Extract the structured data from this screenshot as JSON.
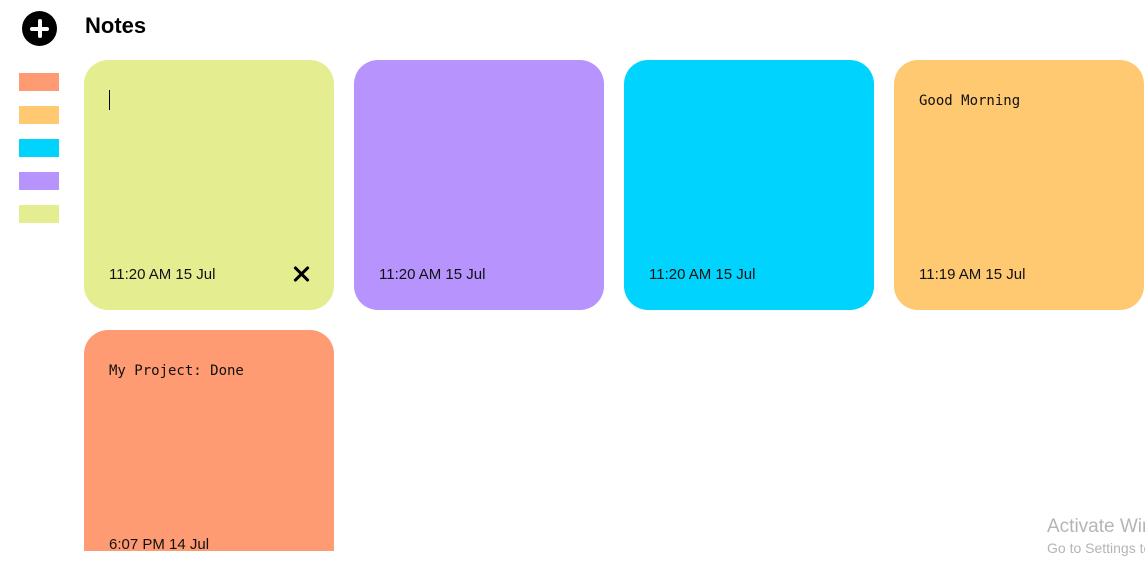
{
  "header": {
    "title": "Notes"
  },
  "sidebar": {
    "add_icon": "plus-circle-icon",
    "swatches": [
      {
        "color": "#fe9b72"
      },
      {
        "color": "#fec971"
      },
      {
        "color": "#00d4fe"
      },
      {
        "color": "#b693fd"
      },
      {
        "color": "#e4ee91"
      }
    ]
  },
  "notes": [
    {
      "text": "",
      "time": "11:20 AM 15 Jul",
      "color": "#e4ee91",
      "editing": true,
      "delete_icon": "close-icon"
    },
    {
      "text": "",
      "time": "11:20 AM 15 Jul",
      "color": "#b693fd"
    },
    {
      "text": "",
      "time": "11:20 AM 15 Jul",
      "color": "#00d4fe"
    },
    {
      "text": "Good Morning",
      "time": "11:19 AM 15 Jul",
      "color": "#fec971"
    },
    {
      "text": "My Project: Done",
      "time": "6:07 PM 14 Jul",
      "color": "#fe9b72"
    }
  ],
  "watermark": {
    "title": "Activate Windows",
    "subtitle": "Go to Settings to activate Windows."
  }
}
